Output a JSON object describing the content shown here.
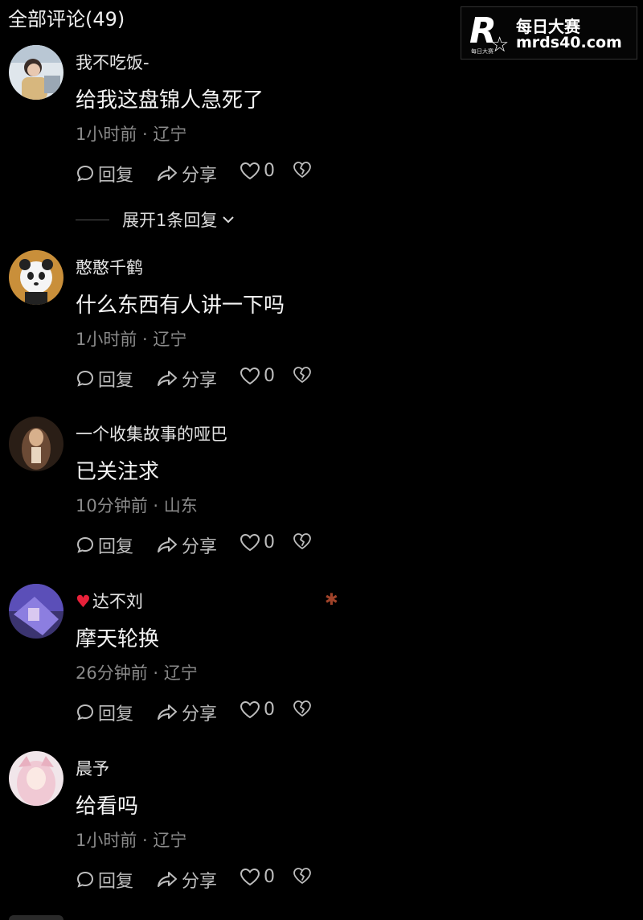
{
  "header": {
    "title": "全部评论(49)"
  },
  "watermark": {
    "logo_letter": "R",
    "logo_small": "每日大赛",
    "name": "每日大赛",
    "url": "mrds40.com"
  },
  "actions": {
    "reply_label": "回复",
    "share_label": "分享"
  },
  "expand_label": "展开1条回复",
  "comments": [
    {
      "username": "我不吃饭-",
      "content": "给我这盘锦人急死了",
      "meta": "1小时前 · 辽宁",
      "likes": "0",
      "avatar_color": "#8fa3b8"
    },
    {
      "username": "憨憨千鹤",
      "content": "什么东西有人讲一下吗",
      "meta": "1小时前 · 辽宁",
      "likes": "0",
      "avatar_color": "#c98f3a"
    },
    {
      "username": "一个收集故事的哑巴",
      "content": "已关注求",
      "meta": "10分钟前 · 山东",
      "likes": "0",
      "avatar_color": "#6b4a35"
    },
    {
      "username": "达不刘",
      "content": "摩天轮换",
      "meta": "26分钟前 · 辽宁",
      "likes": "0",
      "avatar_color": "#5b4fb8"
    },
    {
      "username": "晨予",
      "content": "给看吗",
      "meta": "1小时前 · 辽宁",
      "likes": "0",
      "avatar_color": "#e8c7d0"
    }
  ]
}
